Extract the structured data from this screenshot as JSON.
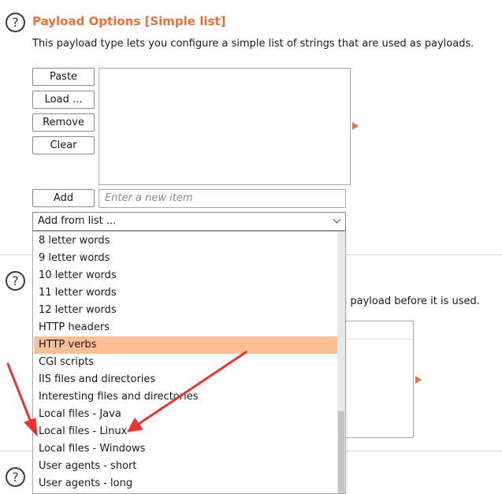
{
  "payload_options": {
    "title": "Payload Options [Simple list]",
    "description": "This payload type lets you configure a simple list of strings that are used as payloads.",
    "buttons": {
      "paste": "Paste",
      "load": "Load ...",
      "remove": "Remove",
      "clear": "Clear",
      "add": "Add"
    },
    "new_item_placeholder": "Enter a new item",
    "add_from_list": {
      "selected": "Add from list ...",
      "options": [
        "8 letter words",
        "9 letter words",
        "10 letter words",
        "11 letter words",
        "12 letter words",
        "HTTP headers",
        "HTTP verbs",
        "CGI scripts",
        "IIS files and directories",
        "Interesting files and directories",
        "Local files - Java",
        "Local files - Linux",
        "Local files - Windows",
        "User agents - short",
        "User agents - long"
      ],
      "highlighted": "HTTP verbs"
    }
  },
  "payload_processing": {
    "description_partial": "n payload before it is used."
  },
  "help_icon_glyph": "?",
  "colors": {
    "accent": "#e8703a",
    "highlight": "#fbbf96",
    "annotation_arrow": "#ee3333"
  }
}
